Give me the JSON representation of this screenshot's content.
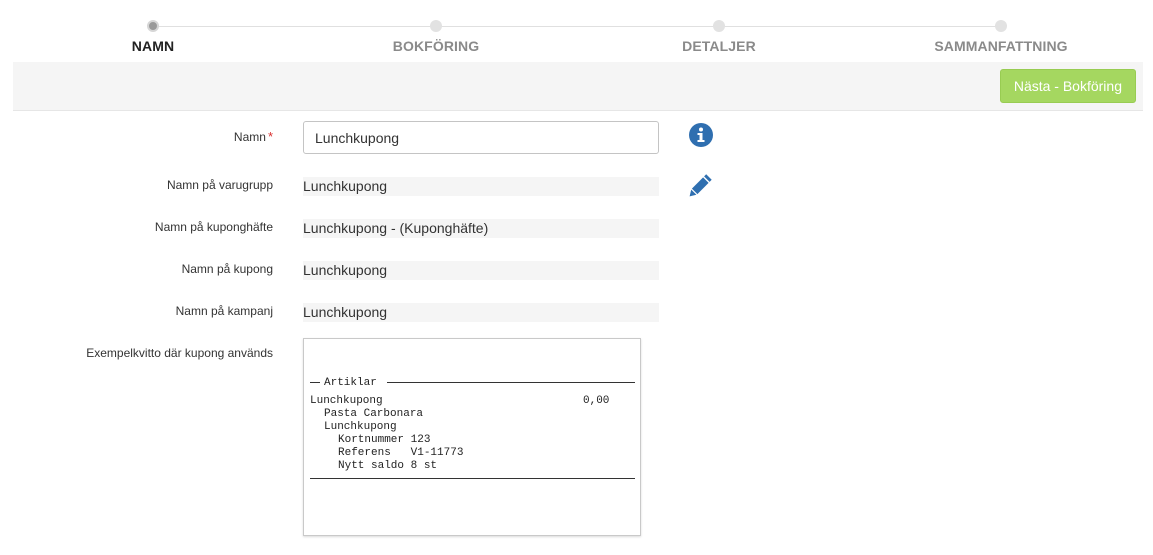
{
  "stepper": {
    "steps": [
      {
        "label": "NAMN",
        "active": true
      },
      {
        "label": "BOKFÖRING",
        "active": false
      },
      {
        "label": "DETALJER",
        "active": false
      },
      {
        "label": "SAMMANFATTNING",
        "active": false
      }
    ]
  },
  "toolbar": {
    "next_label": "Nästa - Bokföring"
  },
  "form": {
    "name": {
      "label": "Namn",
      "required_mark": "*",
      "value": "Lunchkupong"
    },
    "product_group": {
      "label": "Namn på varugrupp",
      "value": "Lunchkupong"
    },
    "coupon_book": {
      "label": "Namn på kuponghäfte",
      "value": "Lunchkupong - (Kuponghäfte)"
    },
    "coupon": {
      "label": "Namn på kupong",
      "value": "Lunchkupong"
    },
    "campaign": {
      "label": "Namn på kampanj",
      "value": "Lunchkupong"
    },
    "receipt_example": {
      "label": "Exempelkvitto där kupong används"
    }
  },
  "receipt": {
    "section_title": "Artiklar",
    "item_name": "Lunchkupong",
    "item_price": "0,00",
    "sub_item": "Pasta Carbonara",
    "coupon_name": "Lunchkupong",
    "card_number": "Kortnummer 123",
    "reference": "Referens   V1-11773",
    "new_balance": "Nytt saldo 8 st"
  },
  "icons": {
    "info": "info-circle-icon",
    "edit": "pencil-icon",
    "accent_color": "#2f6fb0"
  }
}
